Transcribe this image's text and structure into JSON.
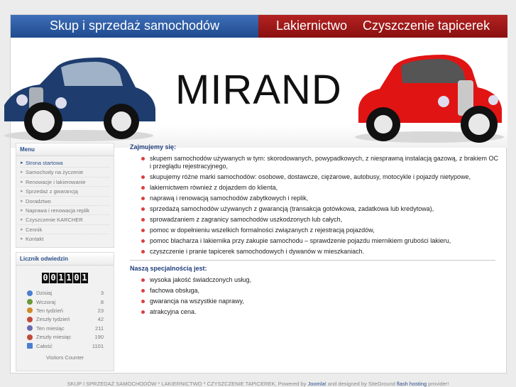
{
  "header": {
    "left_title": "Skup i sprzedaż samochodów",
    "right_items": [
      "Lakiernictwo",
      "Czyszczenie tapicerek"
    ]
  },
  "banner": {
    "logo_text": "MIRAND"
  },
  "menu": {
    "title": "Menu",
    "items": [
      {
        "label": "Strona startowa",
        "active": true
      },
      {
        "label": "Samochody na życzenie"
      },
      {
        "label": "Renowacje i lakierowanie"
      },
      {
        "label": "Sprzedaż z gwarancją"
      },
      {
        "label": "Doradztwo"
      },
      {
        "label": "Naprawa i renowacja replik"
      },
      {
        "label": "Czyszczenie KARCHER"
      },
      {
        "label": "Cennik"
      },
      {
        "label": "Kontakt"
      }
    ]
  },
  "counter": {
    "title": "Licznik odwiedzin",
    "digits": [
      "0",
      "0",
      "1",
      "1",
      "0",
      "1"
    ],
    "stats": [
      {
        "label": "Dzisiaj",
        "value": "3",
        "icon": "user-icon",
        "color": "#4a7fd0"
      },
      {
        "label": "Wczoraj",
        "value": "8",
        "icon": "user-icon",
        "color": "#6a9a3a"
      },
      {
        "label": "Ten tydzień",
        "value": "23",
        "icon": "users-icon",
        "color": "#d08a2a"
      },
      {
        "label": "Zeszły tydzień",
        "value": "42",
        "icon": "users-icon",
        "color": "#c04a3a"
      },
      {
        "label": "Ten miesiąc",
        "value": "211",
        "icon": "users-icon",
        "color": "#6a6ab0"
      },
      {
        "label": "Zeszły miesiąc",
        "value": "190",
        "icon": "users-icon",
        "color": "#c04a3a"
      },
      {
        "label": "Całość",
        "value": "1101",
        "icon": "chart-icon",
        "color": "#4a7fd0"
      }
    ],
    "footer_text": "Visitors Counter"
  },
  "content": {
    "section1_title": "Zajmujemy się:",
    "section1_items": [
      "skupem samochodów używanych w tym: skorodowanych, powypadkowych, z niesprawną instalacją gazową, z brakiem OC i przeglądu rejestracyjnego,",
      "skupujemy różne marki samochodów: osobowe, dostawcze, ciężarowe, autobusy, motocykle i pojazdy nietypowe,",
      "lakiernictwem również z dojazdem do klienta,",
      "naprawą i renowacją samochodów zabytkowych i replik,",
      "sprzedażą samochodów używanych z gwarancją (transakcja gotówkowa, zadatkowa lub kredytowa),",
      "sprowadzaniem z zagranicy samochodów uszkodzonych lub całych,",
      "pomoc w dopełnieniu wszelkich formalności związanych z rejestracją pojazdów,",
      "pomoc blacharza i lakiernika przy zakupie samochodu – sprawdzenie pojazdu miernikiem grubości lakieru,",
      "czyszczenie i pranie tapicerek samochodowych i dywanów w mieszkaniach."
    ],
    "section2_title": "Naszą specjalnością jest:",
    "section2_items": [
      "wysoka jakość świadczonych usług,",
      "fachowa obsługa,",
      "gwarancja na wszystkie naprawy,",
      "atrakcyjna cena."
    ]
  },
  "footer": {
    "text1": "SKUP I SPRZEDAŻ SAMOCHODÓW * LAKIERNICTWO * CZYSZCZENIE TAPICEREK, Powered by",
    "link1": "Joomla!",
    "text2": "and designed by SiteGround",
    "link2": "flash hosting",
    "text3": "provider!"
  },
  "colors": {
    "blue_bar": "#2a5aa3",
    "red_bar": "#a51818",
    "bullet": "#d94040"
  }
}
